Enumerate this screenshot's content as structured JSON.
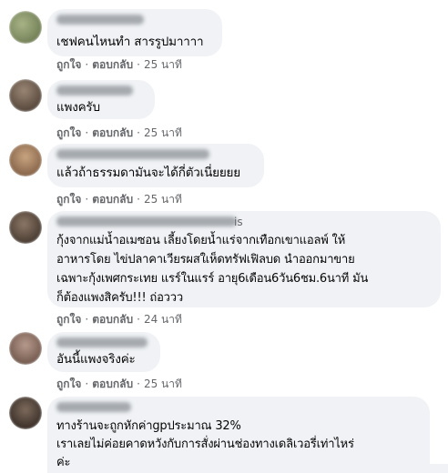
{
  "labels": {
    "like": "ถูกใจ",
    "reply": "ตอบกลับ",
    "sep": "·"
  },
  "comments": [
    {
      "avatar_color": "#7d8a5e",
      "text": "เชฟคนไหนทำ สารรูปมาาาา",
      "time": "25 นาที"
    },
    {
      "avatar_color": "#6b5b4e",
      "text": "แพงครับ",
      "time": "25 นาที"
    },
    {
      "avatar_color": "#a27a5a",
      "text": "แล้วถ้าธรรมดามันจะได้กี่ตัวเนี่ยยยย",
      "time": "25 นาที"
    },
    {
      "avatar_color": "#5a4a3c",
      "author_partial": "is",
      "text": "กุ้งจากแม่น้ำอเมซอน เลี้ยงโดยน้ำแร่จากเทือกเขาแอลพ์ ให้\nอาหารโดย ไข่ปลาคาเวียรผสใเห็ดทรัฟเฟิลบด นำออกมาขาย\nเฉพาะกุ้งเพศกระเทย แรร์ในแรร์ อายุ6เดือน6วัน6ชม.6นาที มัน\nก็ต้องแพงสิครับ!!! ถ่อววว",
      "time": "24 นาที"
    },
    {
      "avatar_color": "#8a6e62",
      "text": "อันนี้แพงจริงค่ะ",
      "time": "25 นาที"
    },
    {
      "avatar_color": "#4d3f36",
      "text": "ทางร้านจะถูกหักค่าgpประมาณ 32%\nเราเลยไม่ค่อยคาดหวังกับการสั่งผ่านช่องทางเดลิเวอรี่เท่าไหร่\nค่ะ"
    }
  ]
}
